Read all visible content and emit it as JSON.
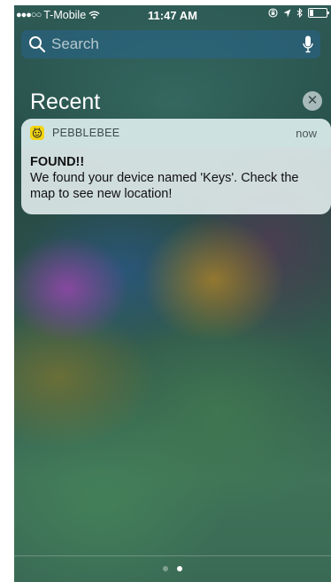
{
  "status_bar": {
    "signal": "●●●○○",
    "carrier": "T-Mobile",
    "time": "11:47 AM",
    "icons": [
      "wifi-icon",
      "rotation-lock-icon",
      "location-icon",
      "bluetooth-icon",
      "battery-icon"
    ]
  },
  "search": {
    "placeholder": "Search"
  },
  "recent": {
    "title": "Recent",
    "clear_symbol": "✕"
  },
  "notification": {
    "app_name": "PEBBLEBEE",
    "time": "now",
    "title": "FOUND!!",
    "message": "We found your device named 'Keys'. Check the map to see new location!",
    "icon_color": "#f2d513"
  },
  "page_indicator": {
    "count": 2,
    "active_index": 1
  }
}
